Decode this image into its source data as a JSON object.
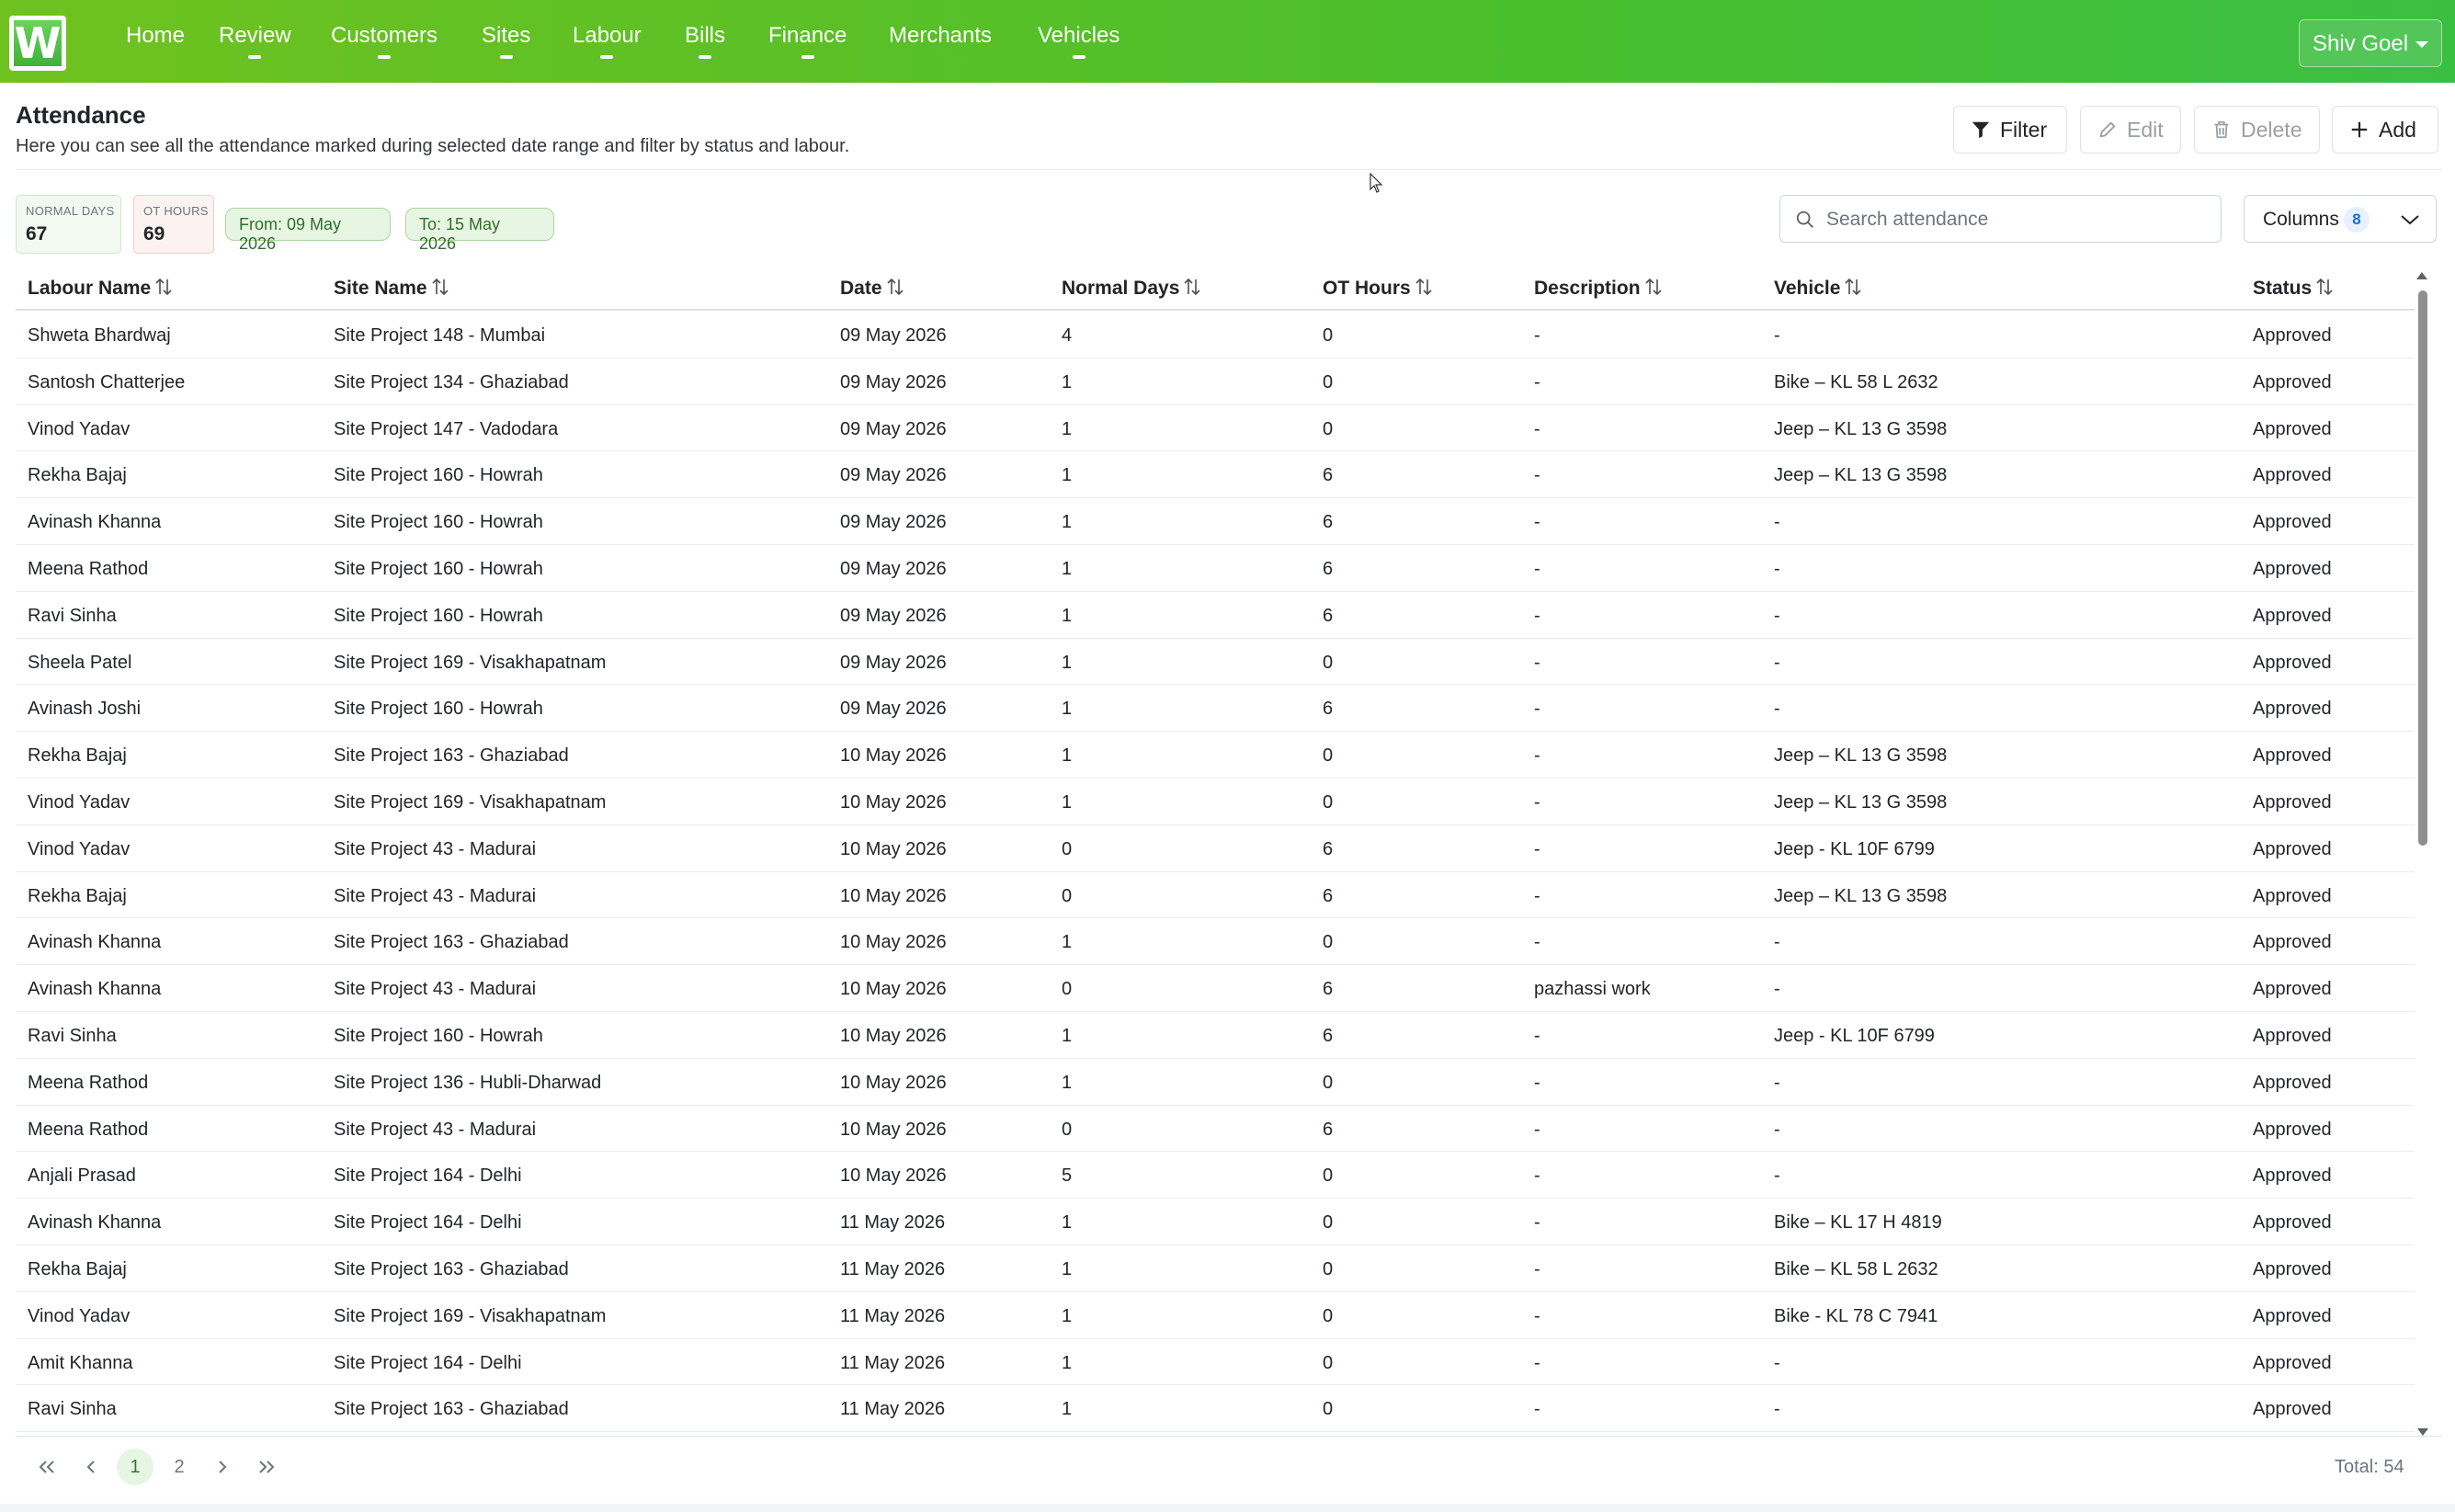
{
  "app": {
    "logo_letter": "W",
    "brand_color": "#4bbf2c"
  },
  "nav": {
    "items": [
      {
        "label": "Home",
        "has_menu": false
      },
      {
        "label": "Review",
        "has_menu": true
      },
      {
        "label": "Customers",
        "has_menu": true
      },
      {
        "label": "Sites",
        "has_menu": true
      },
      {
        "label": "Labour",
        "has_menu": true
      },
      {
        "label": "Bills",
        "has_menu": true
      },
      {
        "label": "Finance",
        "has_menu": true
      },
      {
        "label": "Merchants",
        "has_menu": false
      },
      {
        "label": "Vehicles",
        "has_menu": true
      }
    ],
    "user": "Shiv Goel"
  },
  "header": {
    "title": "Attendance",
    "subtitle": "Here you can see all the attendance marked during selected date range and filter by status and labour.",
    "buttons": {
      "filter": "Filter",
      "edit": "Edit",
      "delete": "Delete",
      "add": "Add"
    }
  },
  "stats": {
    "normal_label": "NORMAL DAYS",
    "normal_value": "67",
    "ot_label": "OT HOURS",
    "ot_value": "69",
    "from": "From: 09 May 2026",
    "to": "To: 15 May 2026"
  },
  "search": {
    "placeholder": "Search attendance",
    "value": ""
  },
  "columns_button": {
    "label": "Columns",
    "count": "8"
  },
  "table": {
    "headers": [
      "Labour Name",
      "Site Name",
      "Date",
      "Normal Days",
      "OT Hours",
      "Description",
      "Vehicle",
      "Status"
    ],
    "rows": [
      [
        "Shweta Bhardwaj",
        "Site Project 148 - Mumbai",
        "09 May 2026",
        "4",
        "0",
        "-",
        "-",
        "Approved"
      ],
      [
        "Santosh Chatterjee",
        "Site Project 134 - Ghaziabad",
        "09 May 2026",
        "1",
        "0",
        "-",
        "Bike – KL 58 L 2632",
        "Approved"
      ],
      [
        "Vinod Yadav",
        "Site Project 147 - Vadodara",
        "09 May 2026",
        "1",
        "0",
        "-",
        "Jeep – KL 13 G 3598",
        "Approved"
      ],
      [
        "Rekha Bajaj",
        "Site Project 160 - Howrah",
        "09 May 2026",
        "1",
        "6",
        "-",
        "Jeep – KL 13 G 3598",
        "Approved"
      ],
      [
        "Avinash Khanna",
        "Site Project 160 - Howrah",
        "09 May 2026",
        "1",
        "6",
        "-",
        "-",
        "Approved"
      ],
      [
        "Meena Rathod",
        "Site Project 160 - Howrah",
        "09 May 2026",
        "1",
        "6",
        "-",
        "-",
        "Approved"
      ],
      [
        "Ravi Sinha",
        "Site Project 160 - Howrah",
        "09 May 2026",
        "1",
        "6",
        "-",
        "-",
        "Approved"
      ],
      [
        "Sheela Patel",
        "Site Project 169 - Visakhapatnam",
        "09 May 2026",
        "1",
        "0",
        "-",
        "-",
        "Approved"
      ],
      [
        "Avinash Joshi",
        "Site Project 160 - Howrah",
        "09 May 2026",
        "1",
        "6",
        "-",
        "-",
        "Approved"
      ],
      [
        "Rekha Bajaj",
        "Site Project 163 - Ghaziabad",
        "10 May 2026",
        "1",
        "0",
        "-",
        "Jeep – KL 13 G 3598",
        "Approved"
      ],
      [
        "Vinod Yadav",
        "Site Project 169 - Visakhapatnam",
        "10 May 2026",
        "1",
        "0",
        "-",
        "Jeep – KL 13 G 3598",
        "Approved"
      ],
      [
        "Vinod Yadav",
        "Site Project 43 - Madurai",
        "10 May 2026",
        "0",
        "6",
        "-",
        "Jeep - KL 10F 6799",
        "Approved"
      ],
      [
        "Rekha Bajaj",
        "Site Project 43 - Madurai",
        "10 May 2026",
        "0",
        "6",
        "-",
        "Jeep – KL 13 G 3598",
        "Approved"
      ],
      [
        "Avinash Khanna",
        "Site Project 163 - Ghaziabad",
        "10 May 2026",
        "1",
        "0",
        "-",
        "-",
        "Approved"
      ],
      [
        "Avinash Khanna",
        "Site Project 43 - Madurai",
        "10 May 2026",
        "0",
        "6",
        "pazhassi work",
        "-",
        "Approved"
      ],
      [
        "Ravi Sinha",
        "Site Project 160 - Howrah",
        "10 May 2026",
        "1",
        "6",
        "-",
        "Jeep - KL 10F 6799",
        "Approved"
      ],
      [
        "Meena Rathod",
        "Site Project 136 - Hubli-Dharwad",
        "10 May 2026",
        "1",
        "0",
        "-",
        "-",
        "Approved"
      ],
      [
        "Meena Rathod",
        "Site Project 43 - Madurai",
        "10 May 2026",
        "0",
        "6",
        "-",
        "-",
        "Approved"
      ],
      [
        "Anjali Prasad",
        "Site Project 164 - Delhi",
        "10 May 2026",
        "5",
        "0",
        "-",
        "-",
        "Approved"
      ],
      [
        "Avinash Khanna",
        "Site Project 164 - Delhi",
        "11 May 2026",
        "1",
        "0",
        "-",
        "Bike – KL 17 H 4819",
        "Approved"
      ],
      [
        "Rekha Bajaj",
        "Site Project 163 - Ghaziabad",
        "11 May 2026",
        "1",
        "0",
        "-",
        "Bike – KL 58 L 2632",
        "Approved"
      ],
      [
        "Vinod Yadav",
        "Site Project 169 - Visakhapatnam",
        "11 May 2026",
        "1",
        "0",
        "-",
        "Bike - KL 78 C 7941",
        "Approved"
      ],
      [
        "Amit Khanna",
        "Site Project 164 - Delhi",
        "11 May 2026",
        "1",
        "0",
        "-",
        "-",
        "Approved"
      ],
      [
        "Ravi Sinha",
        "Site Project 163 - Ghaziabad",
        "11 May 2026",
        "1",
        "0",
        "-",
        "-",
        "Approved"
      ]
    ]
  },
  "pagination": {
    "pages": [
      "1",
      "2"
    ],
    "current": "1",
    "total_label": "Total: 54"
  }
}
